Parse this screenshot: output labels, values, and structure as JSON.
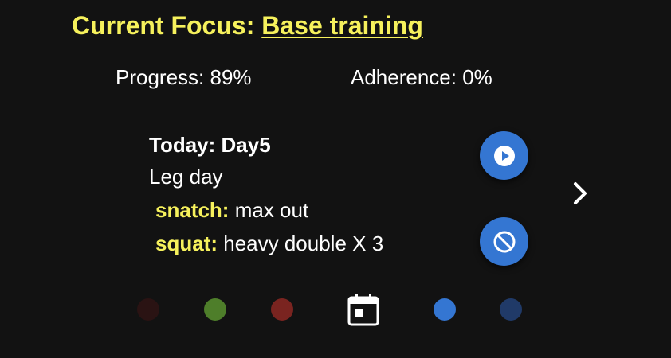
{
  "header": {
    "focus_label": "Current Focus:",
    "focus_value": "Base training"
  },
  "stats": {
    "progress": "Progress: 89%",
    "adherence": "Adherence: 0%"
  },
  "today": {
    "heading": "Today: Day5",
    "name": "Leg day",
    "exercises": [
      {
        "name": "snatch:",
        "detail": "max out"
      },
      {
        "name": "squat:",
        "detail": "heavy double X 3"
      }
    ]
  },
  "actions": {
    "play_icon": "play-circle-icon",
    "skip_icon": "block-icon",
    "next_icon": "chevron-right-icon"
  },
  "day_indicators": {
    "colors": [
      "#2a1313",
      "#4e7e2a",
      "#7a2420",
      "calendar",
      "#3476d2",
      "#203a68"
    ],
    "current_icon": "calendar-icon"
  },
  "colors": {
    "background": "#121212",
    "accent_yellow": "#f6f15c",
    "button_blue": "#3476d2"
  }
}
